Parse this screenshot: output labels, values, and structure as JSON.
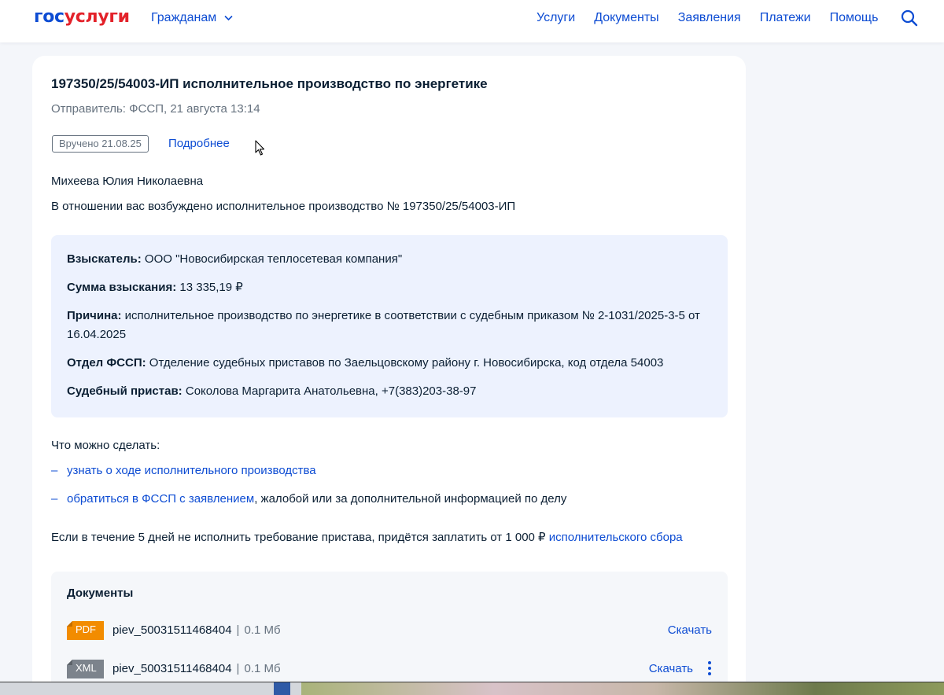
{
  "header": {
    "logo_part1": "гос",
    "logo_part2": "услуги",
    "audience": "Гражданам",
    "nav": [
      "Услуги",
      "Документы",
      "Заявления",
      "Платежи",
      "Помощь"
    ]
  },
  "message": {
    "title": "197350/25/54003-ИП исполнительное производство по энергетике",
    "sender": "Отправитель: ФССП, 21 августа 13:14",
    "badge": "Вручено 21.08.25",
    "more_link": "Подробнее",
    "recipient": "Михеева Юлия Николаевна",
    "intro": "В отношении вас возбуждено исполнительное производство № 197350/25/54003-ИП"
  },
  "details": {
    "creditor_label": "Взыскатель:",
    "creditor_value": " ООО \"Новосибирская теплосетевая компания\"",
    "amount_label": "Сумма взыскания:",
    "amount_value": " 13 335,19 ₽",
    "reason_label": "Причина:",
    "reason_value": " исполнительное производство по энергетике в соответствии с судебным приказом № 2-1031/2025-3-5 от 16.04.2025",
    "department_label": "Отдел ФССП:",
    "department_value": " Отделение судебных приставов по Заельцовскому району г. Новосибирска, код отдела 54003",
    "bailiff_label": "Судебный пристав:",
    "bailiff_value": " Соколова Маргарита Анатольевна, +7(383)203-38-97"
  },
  "actions": {
    "title": "Что можно сделать:",
    "dash": "–",
    "item1_link": "узнать о ходе исполнительного производства",
    "item2_link": "обратиться в ФССП с заявлением",
    "item2_rest": ", жалобой или за дополнительной информацией по делу"
  },
  "fee": {
    "text": "Если в течение 5 дней не исполнить требование пристава, придётся заплатить от 1 000 ₽ ",
    "link": "исполнительского сбора"
  },
  "documents": {
    "title": "Документы",
    "separator": "|",
    "files": [
      {
        "type": "PDF",
        "name": "piev_50031511468404",
        "size": "0.1 Мб",
        "download": "Скачать",
        "color": "#f28c00"
      },
      {
        "type": "XML",
        "name": "piev_50031511468404",
        "size": "0.1 Мб",
        "download": "Скачать",
        "color": "#7c838c"
      }
    ]
  },
  "colors": {
    "accent": "#0d4cd3",
    "logo_red": "#e3222a",
    "info_bg": "#edf2fe"
  }
}
